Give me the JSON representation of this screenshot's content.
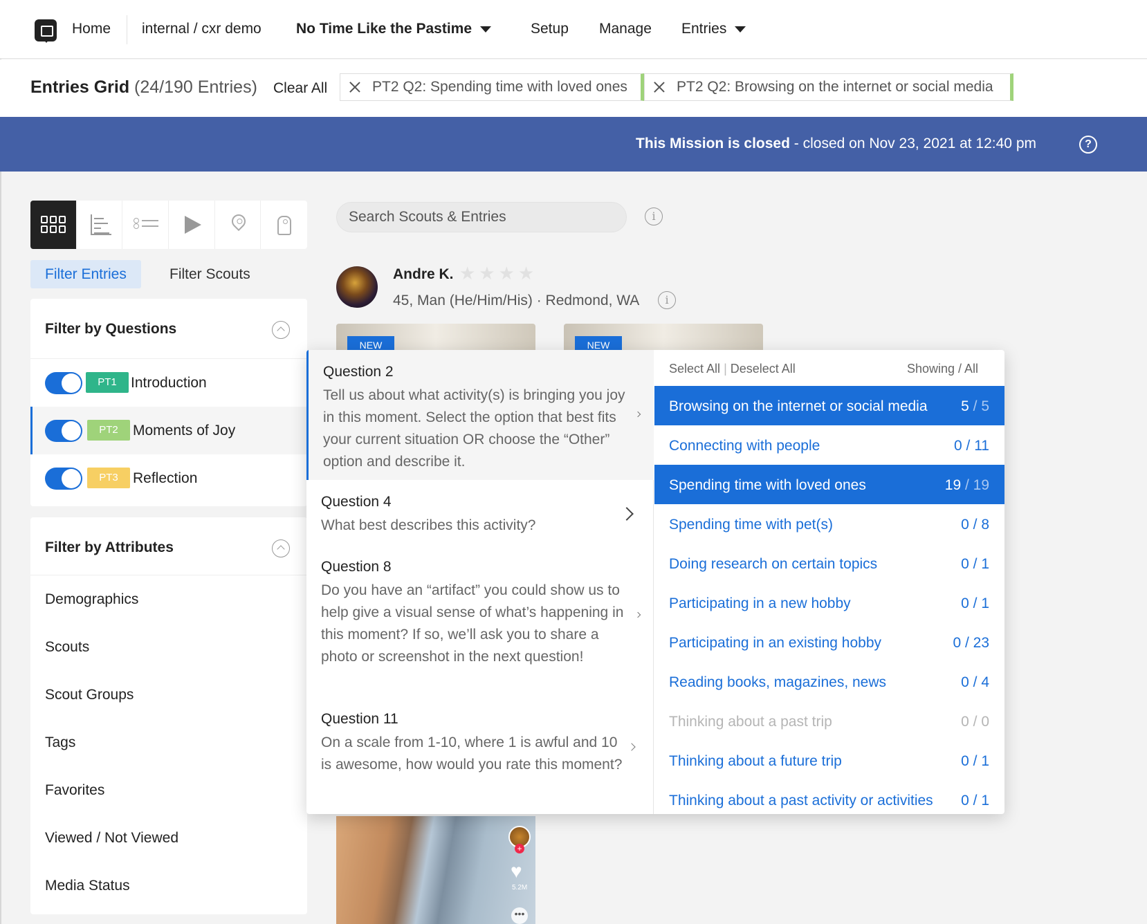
{
  "nav": {
    "home": "Home",
    "workspace": "internal / cxr demo",
    "mission": "No Time Like the Pastime",
    "setup": "Setup",
    "manage": "Manage",
    "entries": "Entries"
  },
  "grid": {
    "title": "Entries Grid",
    "count": "(24/190 Entries)",
    "clear_all": "Clear All",
    "chips": [
      "PT2 Q2: Spending time with loved ones",
      "PT2 Q2: Browsing on the internet or social media"
    ]
  },
  "banner": {
    "bold": "This Mission is closed",
    "rest": " - closed on Nov 23, 2021 at 12:40 pm"
  },
  "filter_tabs": {
    "entries": "Filter Entries",
    "scouts": "Filter Scouts"
  },
  "questions_panel": {
    "title": "Filter by Questions",
    "items": [
      {
        "badge": "PT1",
        "label": "Introduction",
        "color": "#2fb58a"
      },
      {
        "badge": "PT2",
        "label": "Moments of Joy",
        "color": "#9fd37a"
      },
      {
        "badge": "PT3",
        "label": "Reflection",
        "color": "#f7cf63"
      }
    ]
  },
  "attributes_panel": {
    "title": "Filter by Attributes",
    "items": [
      "Demographics",
      "Scouts",
      "Scout Groups",
      "Tags",
      "Favorites",
      "Viewed / Not Viewed",
      "Media Status"
    ]
  },
  "search": {
    "placeholder": "Search Scouts & Entries"
  },
  "scout": {
    "name": "Andre K.",
    "meta": "45, Man (He/Him/His) · Redmond, WA",
    "stars": "★★★★"
  },
  "thumbs": {
    "new": "NEW"
  },
  "video": {
    "plus": "+",
    "heart": "♥",
    "count": "5.2M",
    "dots": "•••"
  },
  "dropdown": {
    "questions": [
      {
        "num": "Question 2",
        "text": "Tell us about what activity(s) is bringing you joy in this moment. Select the option that best fits your current situation OR choose the “Other” option and describe it."
      },
      {
        "num": "Question 4",
        "text": "What best describes this activity?"
      },
      {
        "num": "Question 8",
        "text": "Do you have an “artifact” you could show us to help give a visual sense of what’s happening in this moment? If so, we’ll ask you to share a photo or screenshot in the next question!"
      },
      {
        "num": "Question 11",
        "text": "On a scale from 1-10, where 1 is awful and 10 is awesome, how would you rate this moment?"
      }
    ],
    "select_all": "Select All",
    "deselect_all": "Deselect All",
    "separator": "|",
    "showing": "Showing / All",
    "answers": [
      {
        "label": "Browsing on the internet or social media",
        "shown": "5",
        "total": "5"
      },
      {
        "label": "Connecting with people",
        "shown": "0",
        "total": "11"
      },
      {
        "label": "Spending time with loved ones",
        "shown": "19",
        "total": "19"
      },
      {
        "label": "Spending time with pet(s)",
        "shown": "0",
        "total": "8"
      },
      {
        "label": "Doing research on certain topics",
        "shown": "0",
        "total": "1"
      },
      {
        "label": "Participating in a new hobby",
        "shown": "0",
        "total": "1"
      },
      {
        "label": "Participating in an existing hobby",
        "shown": "0",
        "total": "23"
      },
      {
        "label": "Reading books, magazines, news",
        "shown": "0",
        "total": "4"
      },
      {
        "label": "Thinking about a past trip",
        "shown": "0",
        "total": "0"
      },
      {
        "label": "Thinking about a future trip",
        "shown": "0",
        "total": "1"
      },
      {
        "label": "Thinking about a past activity or activities",
        "shown": "0",
        "total": "1"
      }
    ]
  },
  "colors": {
    "accent": "#1a6ed8",
    "banner": "#4460a6",
    "chip_border": "#9fd37a"
  }
}
